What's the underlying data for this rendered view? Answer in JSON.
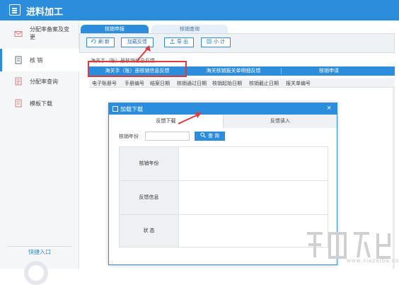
{
  "app": {
    "title": "进料加工"
  },
  "sidebar": {
    "items": [
      {
        "label": "分配率备案及变更",
        "icon": "envelope-icon"
      },
      {
        "label": "核 销",
        "icon": "document-icon"
      },
      {
        "label": "分配率查询",
        "icon": "list-document-icon"
      },
      {
        "label": "模板下载",
        "icon": "template-icon"
      }
    ],
    "quick_entry": "快捷入口"
  },
  "tabs": [
    {
      "label": "核销申报",
      "active": true
    },
    {
      "label": "核销查询",
      "active": false
    }
  ],
  "toolbar": {
    "refresh": "刷 新",
    "feedback": "加载反馈",
    "export": "导 出",
    "subtotal": "小 计"
  },
  "breadcrumb": "海关手（账）册核销信息反馈",
  "blue_bar": {
    "items": [
      "海关手（账）册核销信息反馈",
      "海关核销报关单明细反馈",
      "核销申请"
    ]
  },
  "columns": [
    "电子账册号",
    "手册编号",
    "结案日期",
    "核销通过日期",
    "核销起始日期",
    "核销截止日期",
    "报关单编号"
  ],
  "modal": {
    "title": "加载下载",
    "tabs": [
      "反馈下载",
      "反馈读入"
    ],
    "year_label": "核销年份",
    "year_value": "",
    "query_button": "查 询",
    "rows": [
      "核销年份",
      "反馈信息",
      "状 态"
    ]
  },
  "watermark": "www.xiazaiba.com",
  "colors": {
    "accent": "#2b8ddc",
    "highlight": "#e0393c"
  }
}
